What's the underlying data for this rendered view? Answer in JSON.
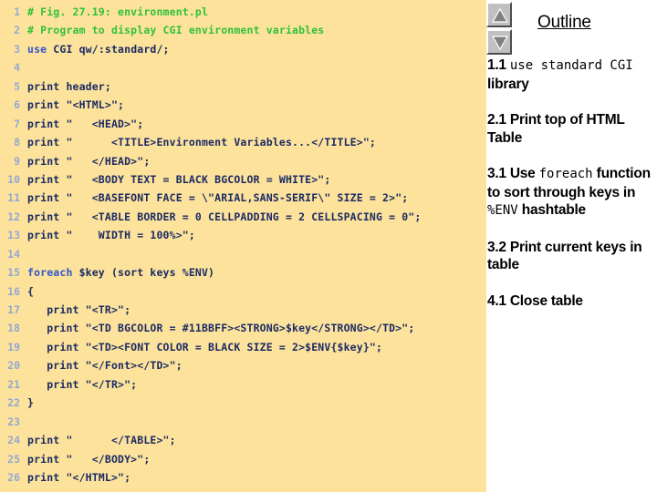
{
  "slide": {
    "background_color": "#ffffff",
    "code_panel_color": "#fce29a"
  },
  "code": {
    "language": "perl",
    "comment_color": "#2fc23a",
    "keyword_color": "#3355cc",
    "text_color": "#1b2a66",
    "lineno_color": "#93a8d4",
    "lines": [
      {
        "n": "1",
        "text": "# Fig. 27.19: environment.pl",
        "style": "comment"
      },
      {
        "n": "2",
        "text": "# Program to display CGI environment variables",
        "style": "comment"
      },
      {
        "n": "3",
        "text": "use CGI qw/:standard/;",
        "style": "keyword",
        "keyword": "use"
      },
      {
        "n": "4",
        "text": "",
        "style": "plain"
      },
      {
        "n": "5",
        "text": "print header;",
        "style": "plain"
      },
      {
        "n": "6",
        "text": "print \"<HTML>\";",
        "style": "plain"
      },
      {
        "n": "7",
        "text": "print \"   <HEAD>\";",
        "style": "plain"
      },
      {
        "n": "8",
        "text": "print \"      <TITLE>Environment Variables...</TITLE>\";",
        "style": "plain"
      },
      {
        "n": "9",
        "text": "print \"   </HEAD>\";",
        "style": "plain"
      },
      {
        "n": "10",
        "text": "print \"   <BODY TEXT = BLACK BGCOLOR = WHITE>\";",
        "style": "plain"
      },
      {
        "n": "11",
        "text": "print \"   <BASEFONT FACE = \\\"ARIAL,SANS-SERIF\\\" SIZE = 2>\";",
        "style": "plain"
      },
      {
        "n": "12",
        "text": "print \"   <TABLE BORDER = 0 CELLPADDING = 2 CELLSPACING = 0\";",
        "style": "plain"
      },
      {
        "n": "13",
        "text": "print \"    WIDTH = 100%>\";",
        "style": "plain"
      },
      {
        "n": "14",
        "text": "",
        "style": "plain"
      },
      {
        "n": "15",
        "text": "foreach $key (sort keys %ENV)",
        "style": "keyword",
        "keyword": "foreach"
      },
      {
        "n": "16",
        "text": "{",
        "style": "plain"
      },
      {
        "n": "17",
        "text": "   print \"<TR>\";",
        "style": "plain"
      },
      {
        "n": "18",
        "text": "   print \"<TD BGCOLOR = #11BBFF><STRONG>$key</STRONG></TD>\";",
        "style": "plain"
      },
      {
        "n": "19",
        "text": "   print \"<TD><FONT COLOR = BLACK SIZE = 2>$ENV{$key}\";",
        "style": "plain"
      },
      {
        "n": "20",
        "text": "   print \"</Font></TD>\";",
        "style": "plain"
      },
      {
        "n": "21",
        "text": "   print \"</TR>\";",
        "style": "plain"
      },
      {
        "n": "22",
        "text": "}",
        "style": "plain"
      },
      {
        "n": "23",
        "text": "",
        "style": "plain"
      },
      {
        "n": "24",
        "text": "print \"      </TABLE>\";",
        "style": "plain"
      },
      {
        "n": "25",
        "text": "print \"   </BODY>\";",
        "style": "plain"
      },
      {
        "n": "26",
        "text": "print \"</HTML>\";",
        "style": "plain"
      }
    ]
  },
  "outline": {
    "title": "Outline",
    "scroll_up_icon": "triangle-up-icon",
    "scroll_down_icon": "triangle-down-icon",
    "items": [
      {
        "id": "1.1",
        "segments": [
          {
            "text": "1.1 ",
            "mono": false
          },
          {
            "text": "use standard CGI",
            "mono": true
          },
          {
            "text": " library",
            "mono": false
          }
        ]
      },
      {
        "id": "2.1",
        "segments": [
          {
            "text": "2.1 Print top of HTML Table",
            "mono": false
          }
        ]
      },
      {
        "id": "3.1",
        "segments": [
          {
            "text": "3.1 Use ",
            "mono": false
          },
          {
            "text": "foreach",
            "mono": true
          },
          {
            "text": " function to sort through keys in ",
            "mono": false
          },
          {
            "text": "%ENV",
            "mono": true
          },
          {
            "text": " hashtable",
            "mono": false
          }
        ]
      },
      {
        "id": "3.2",
        "segments": [
          {
            "text": "3.2 Print current keys in table",
            "mono": false
          }
        ]
      },
      {
        "id": "4.1",
        "segments": [
          {
            "text": "4.1 Close table",
            "mono": false
          }
        ]
      }
    ]
  }
}
